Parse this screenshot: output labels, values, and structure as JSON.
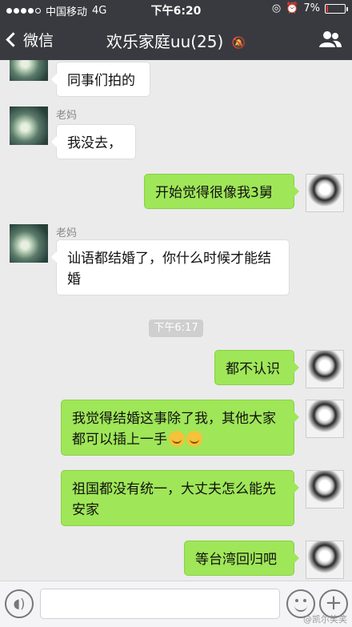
{
  "status_bar": {
    "carrier": "中国移动",
    "network": "4G",
    "time": "下午6:20",
    "battery": "7%"
  },
  "header": {
    "back_label": "微信",
    "title": "欢乐家庭uu(25)",
    "mute_icon": "bell-slash-icon",
    "members_icon": "people-icon"
  },
  "messages": [
    {
      "side": "left",
      "sender": "",
      "text": "同事们拍的"
    },
    {
      "side": "left",
      "sender": "老妈",
      "text": "我没去，"
    },
    {
      "side": "right",
      "sender": "",
      "text": "开始觉得很像我3舅"
    },
    {
      "side": "left",
      "sender": "老妈",
      "text": "讪语都结婚了，你什么时候才能结婚"
    },
    {
      "side": "right",
      "sender": "",
      "text": "都不认识"
    },
    {
      "side": "right",
      "sender": "",
      "text": "我觉得结婚这事除了我，其他大家都可以插上一手"
    },
    {
      "side": "right",
      "sender": "",
      "text": "祖国都没有统一，大丈夫怎么能先安家"
    },
    {
      "side": "right",
      "sender": "",
      "text": "等台湾回归吧"
    }
  ],
  "time_badge": "下午6:17",
  "input_bar": {
    "voice_icon": "voice-icon",
    "emoji_icon": "smile-icon",
    "plus_icon": "plus-icon"
  },
  "watermark": "@凯尔笑笑"
}
